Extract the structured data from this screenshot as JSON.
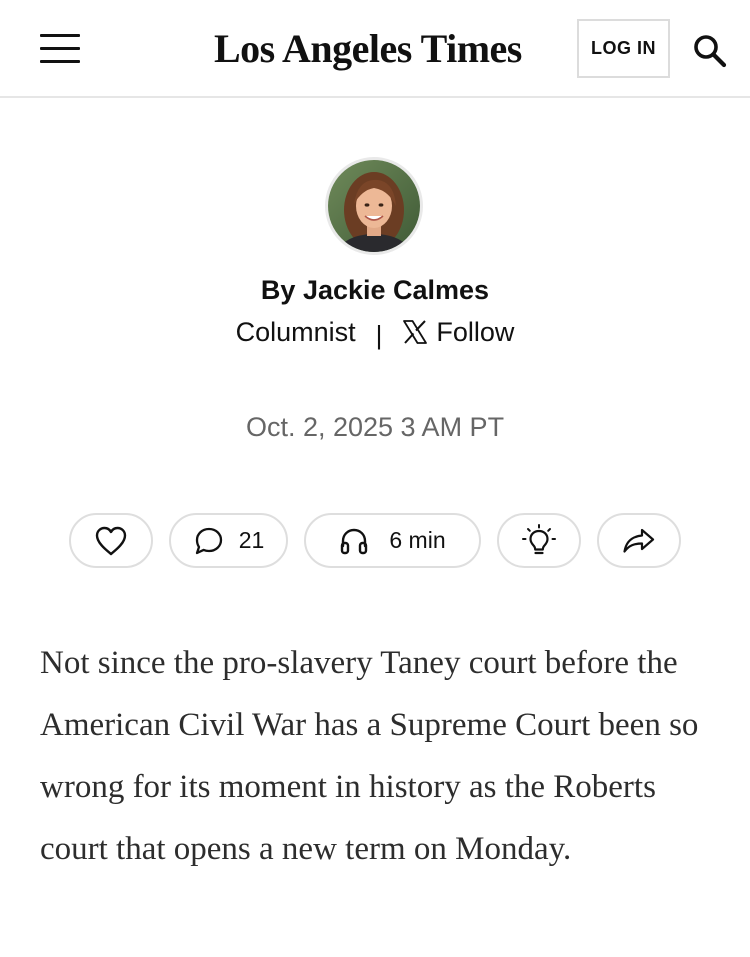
{
  "header": {
    "logo": "Los Angeles Times",
    "login_label": "LOG IN",
    "menu_icon": "hamburger-menu-icon",
    "search_icon": "search-icon"
  },
  "byline": {
    "author": "By Jackie Calmes",
    "role": "Columnist",
    "separator": "|",
    "follow_label": "Follow",
    "follow_icon": "x-logo-icon"
  },
  "date": "Oct. 2, 2025 3 AM PT",
  "actions": {
    "like_icon": "heart-icon",
    "comment_icon": "comment-icon",
    "comment_count": "21",
    "listen_icon": "headphones-icon",
    "listen_label": "6 min",
    "insight_icon": "lightbulb-icon",
    "share_icon": "share-icon"
  },
  "article": {
    "lead": "Not since the pro-slavery Taney court before the American Civil War has a Supreme Court been so wrong for its moment in history as the Roberts court that opens a new term on Monday."
  },
  "colors": {
    "text": "#111111",
    "muted": "#666666",
    "body_text": "#2d2d2d",
    "border": "#dedede"
  }
}
